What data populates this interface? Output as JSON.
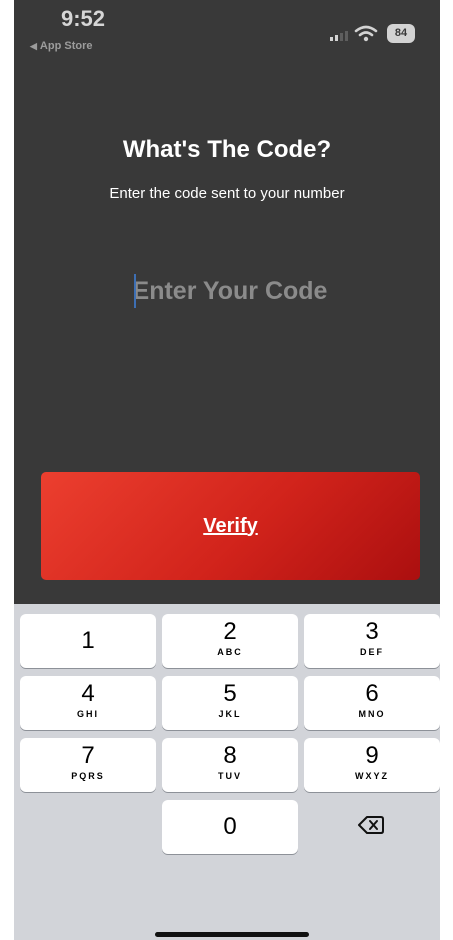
{
  "status_bar": {
    "time": "9:52",
    "back_label": "App Store",
    "battery": "84"
  },
  "screen": {
    "title": "What's The Code?",
    "subtitle": "Enter the code sent to your number",
    "code_placeholder": "Enter Your Code",
    "verify_label": "Verify",
    "accent_color": "#d1231b"
  },
  "keyboard": {
    "keys": [
      {
        "digit": "1",
        "letters": ""
      },
      {
        "digit": "2",
        "letters": "ABC"
      },
      {
        "digit": "3",
        "letters": "DEF"
      },
      {
        "digit": "4",
        "letters": "GHI"
      },
      {
        "digit": "5",
        "letters": "JKL"
      },
      {
        "digit": "6",
        "letters": "MNO"
      },
      {
        "digit": "7",
        "letters": "PQRS"
      },
      {
        "digit": "8",
        "letters": "TUV"
      },
      {
        "digit": "9",
        "letters": "WXYZ"
      },
      {
        "digit": "0",
        "letters": ""
      }
    ],
    "delete_icon": "backspace-icon"
  }
}
